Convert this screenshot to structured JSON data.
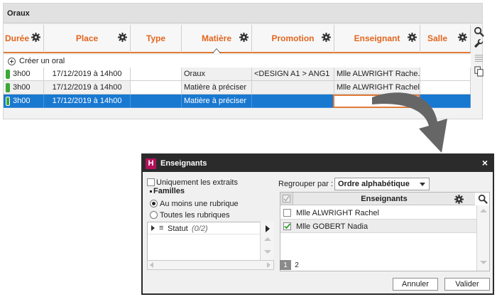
{
  "oraux": {
    "title": "Oraux",
    "columns": [
      {
        "label": "Durée",
        "sorted": false
      },
      {
        "label": "Place",
        "sorted": false
      },
      {
        "label": "Type",
        "sorted": false
      },
      {
        "label": "Matière",
        "sorted": true
      },
      {
        "label": "Promotion",
        "sorted": false
      },
      {
        "label": "Enseignant",
        "sorted": false
      },
      {
        "label": "Salle",
        "sorted": false
      }
    ],
    "create_label": "Créer un oral",
    "rows": [
      {
        "duree": "3h00",
        "place": "17/12/2019  à 14h00",
        "type": "",
        "matiere": "Oraux",
        "promotion": "<DESIGN A1 > ANG1",
        "enseignant": "Mlle ALWRIGHT Rache...",
        "salle": "",
        "selected": false
      },
      {
        "duree": "3h00",
        "place": "17/12/2019  à 14h00",
        "type": "",
        "matiere": "Matière à préciser",
        "promotion": "",
        "enseignant": "Mlle ALWRIGHT Rachel",
        "salle": "",
        "selected": false
      },
      {
        "duree": "3h00",
        "place": "17/12/2019  à 14h00",
        "type": "",
        "matiere": "Matière à préciser",
        "promotion": "",
        "enseignant": "",
        "salle": "",
        "selected": true
      }
    ],
    "colors": {
      "accent": "#e2661e",
      "selection": "#1978d0",
      "pill": "#3aa935"
    }
  },
  "dialog": {
    "logo": "H",
    "title": "Enseignants",
    "close_glyph": "×",
    "only_extracts": "Uniquement les extraits",
    "families_label": "Familles",
    "radio_options": [
      {
        "label": "Au moins une rubrique",
        "checked": true
      },
      {
        "label": "Toutes les rubriques",
        "checked": false
      }
    ],
    "tree_item": {
      "label": "Statut",
      "count": "(0/2)"
    },
    "group_by_label": "Regrouper par :",
    "group_by_value": "Ordre alphabétique",
    "list_header": "Enseignants",
    "teachers": [
      {
        "name": "Mlle ALWRIGHT Rachel",
        "checked": false
      },
      {
        "name": "Mlle GOBERT Nadia",
        "checked": true
      }
    ],
    "pages": [
      "1",
      "2"
    ],
    "current_page": "1",
    "cancel_label": "Annuler",
    "ok_label": "Valider"
  }
}
